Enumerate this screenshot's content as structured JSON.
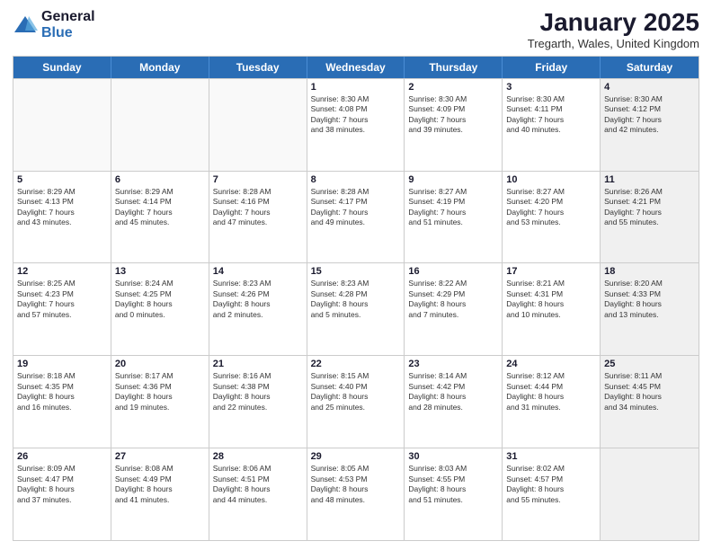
{
  "logo": {
    "general": "General",
    "blue": "Blue"
  },
  "title": "January 2025",
  "location": "Tregarth, Wales, United Kingdom",
  "weekdays": [
    "Sunday",
    "Monday",
    "Tuesday",
    "Wednesday",
    "Thursday",
    "Friday",
    "Saturday"
  ],
  "weeks": [
    [
      {
        "day": "",
        "text": "",
        "empty": true
      },
      {
        "day": "",
        "text": "",
        "empty": true
      },
      {
        "day": "",
        "text": "",
        "empty": true
      },
      {
        "day": "1",
        "text": "Sunrise: 8:30 AM\nSunset: 4:08 PM\nDaylight: 7 hours\nand 38 minutes."
      },
      {
        "day": "2",
        "text": "Sunrise: 8:30 AM\nSunset: 4:09 PM\nDaylight: 7 hours\nand 39 minutes."
      },
      {
        "day": "3",
        "text": "Sunrise: 8:30 AM\nSunset: 4:11 PM\nDaylight: 7 hours\nand 40 minutes."
      },
      {
        "day": "4",
        "text": "Sunrise: 8:30 AM\nSunset: 4:12 PM\nDaylight: 7 hours\nand 42 minutes.",
        "shaded": true
      }
    ],
    [
      {
        "day": "5",
        "text": "Sunrise: 8:29 AM\nSunset: 4:13 PM\nDaylight: 7 hours\nand 43 minutes."
      },
      {
        "day": "6",
        "text": "Sunrise: 8:29 AM\nSunset: 4:14 PM\nDaylight: 7 hours\nand 45 minutes."
      },
      {
        "day": "7",
        "text": "Sunrise: 8:28 AM\nSunset: 4:16 PM\nDaylight: 7 hours\nand 47 minutes."
      },
      {
        "day": "8",
        "text": "Sunrise: 8:28 AM\nSunset: 4:17 PM\nDaylight: 7 hours\nand 49 minutes."
      },
      {
        "day": "9",
        "text": "Sunrise: 8:27 AM\nSunset: 4:19 PM\nDaylight: 7 hours\nand 51 minutes."
      },
      {
        "day": "10",
        "text": "Sunrise: 8:27 AM\nSunset: 4:20 PM\nDaylight: 7 hours\nand 53 minutes."
      },
      {
        "day": "11",
        "text": "Sunrise: 8:26 AM\nSunset: 4:21 PM\nDaylight: 7 hours\nand 55 minutes.",
        "shaded": true
      }
    ],
    [
      {
        "day": "12",
        "text": "Sunrise: 8:25 AM\nSunset: 4:23 PM\nDaylight: 7 hours\nand 57 minutes."
      },
      {
        "day": "13",
        "text": "Sunrise: 8:24 AM\nSunset: 4:25 PM\nDaylight: 8 hours\nand 0 minutes."
      },
      {
        "day": "14",
        "text": "Sunrise: 8:23 AM\nSunset: 4:26 PM\nDaylight: 8 hours\nand 2 minutes."
      },
      {
        "day": "15",
        "text": "Sunrise: 8:23 AM\nSunset: 4:28 PM\nDaylight: 8 hours\nand 5 minutes."
      },
      {
        "day": "16",
        "text": "Sunrise: 8:22 AM\nSunset: 4:29 PM\nDaylight: 8 hours\nand 7 minutes."
      },
      {
        "day": "17",
        "text": "Sunrise: 8:21 AM\nSunset: 4:31 PM\nDaylight: 8 hours\nand 10 minutes."
      },
      {
        "day": "18",
        "text": "Sunrise: 8:20 AM\nSunset: 4:33 PM\nDaylight: 8 hours\nand 13 minutes.",
        "shaded": true
      }
    ],
    [
      {
        "day": "19",
        "text": "Sunrise: 8:18 AM\nSunset: 4:35 PM\nDaylight: 8 hours\nand 16 minutes."
      },
      {
        "day": "20",
        "text": "Sunrise: 8:17 AM\nSunset: 4:36 PM\nDaylight: 8 hours\nand 19 minutes."
      },
      {
        "day": "21",
        "text": "Sunrise: 8:16 AM\nSunset: 4:38 PM\nDaylight: 8 hours\nand 22 minutes."
      },
      {
        "day": "22",
        "text": "Sunrise: 8:15 AM\nSunset: 4:40 PM\nDaylight: 8 hours\nand 25 minutes."
      },
      {
        "day": "23",
        "text": "Sunrise: 8:14 AM\nSunset: 4:42 PM\nDaylight: 8 hours\nand 28 minutes."
      },
      {
        "day": "24",
        "text": "Sunrise: 8:12 AM\nSunset: 4:44 PM\nDaylight: 8 hours\nand 31 minutes."
      },
      {
        "day": "25",
        "text": "Sunrise: 8:11 AM\nSunset: 4:45 PM\nDaylight: 8 hours\nand 34 minutes.",
        "shaded": true
      }
    ],
    [
      {
        "day": "26",
        "text": "Sunrise: 8:09 AM\nSunset: 4:47 PM\nDaylight: 8 hours\nand 37 minutes."
      },
      {
        "day": "27",
        "text": "Sunrise: 8:08 AM\nSunset: 4:49 PM\nDaylight: 8 hours\nand 41 minutes."
      },
      {
        "day": "28",
        "text": "Sunrise: 8:06 AM\nSunset: 4:51 PM\nDaylight: 8 hours\nand 44 minutes."
      },
      {
        "day": "29",
        "text": "Sunrise: 8:05 AM\nSunset: 4:53 PM\nDaylight: 8 hours\nand 48 minutes."
      },
      {
        "day": "30",
        "text": "Sunrise: 8:03 AM\nSunset: 4:55 PM\nDaylight: 8 hours\nand 51 minutes."
      },
      {
        "day": "31",
        "text": "Sunrise: 8:02 AM\nSunset: 4:57 PM\nDaylight: 8 hours\nand 55 minutes."
      },
      {
        "day": "",
        "text": "",
        "empty": true,
        "shaded": true
      }
    ]
  ]
}
